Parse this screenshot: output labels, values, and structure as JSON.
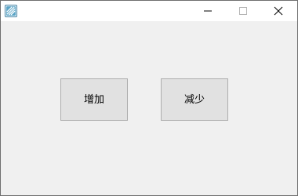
{
  "window": {
    "title": "",
    "icons": {
      "app": "app-icon",
      "minimize": "minimize-icon",
      "maximize": "maximize-icon",
      "close": "close-icon"
    },
    "accent_color": "#3b7ea1"
  },
  "buttons": {
    "increase_label": "增加",
    "decrease_label": "减少"
  }
}
